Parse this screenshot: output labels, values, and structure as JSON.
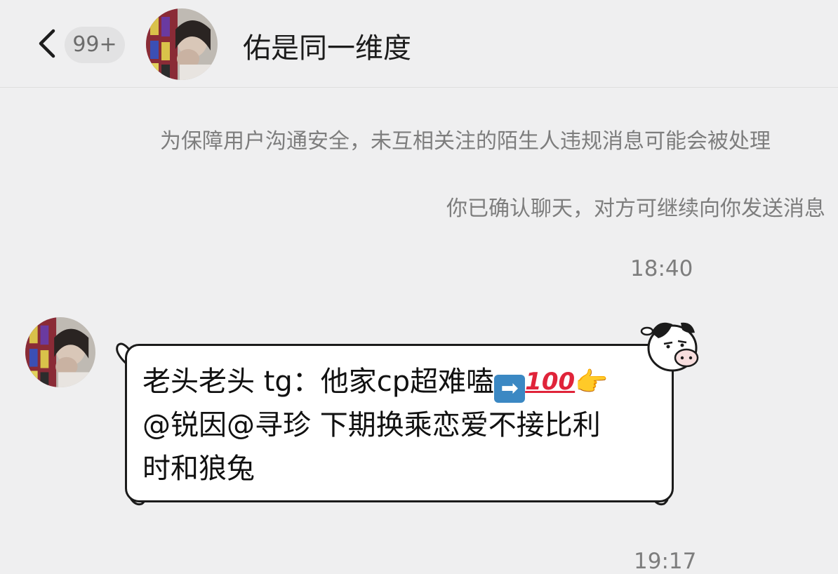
{
  "header": {
    "unread_badge": "99+",
    "title": "佑是同一维度"
  },
  "notices": [
    "为保障用户沟通安全，未互相关注的陌生人违规消息可能会被处理",
    "你已确认聊天，对方可继续向你发送消息"
  ],
  "timestamps": [
    "18:40",
    "19:17"
  ],
  "message": {
    "line1_text": "老头老头 tg：他家cp超难嗑",
    "arrow_emoji": "➡",
    "hundred_emoji": "100",
    "point_emoji": "👉",
    "line2_text": "@锐因@寻珍  下期换乘恋爱不接比利",
    "line3_text": "时和狼兔"
  },
  "icons": {
    "back": "chevron-left-icon",
    "emoji_arrow": "right-arrow-emoji-icon",
    "emoji_100": "hundred-points-emoji-icon",
    "emoji_point": "pointing-hand-emoji-icon",
    "bubble_decor": "cow-head-icon"
  },
  "colors": {
    "background": "#efeff0",
    "badge_bg": "#e2e2e3",
    "text_primary": "#1c1c1c",
    "text_secondary": "#7d7d7d",
    "bubble_border": "#1b1b1b"
  }
}
